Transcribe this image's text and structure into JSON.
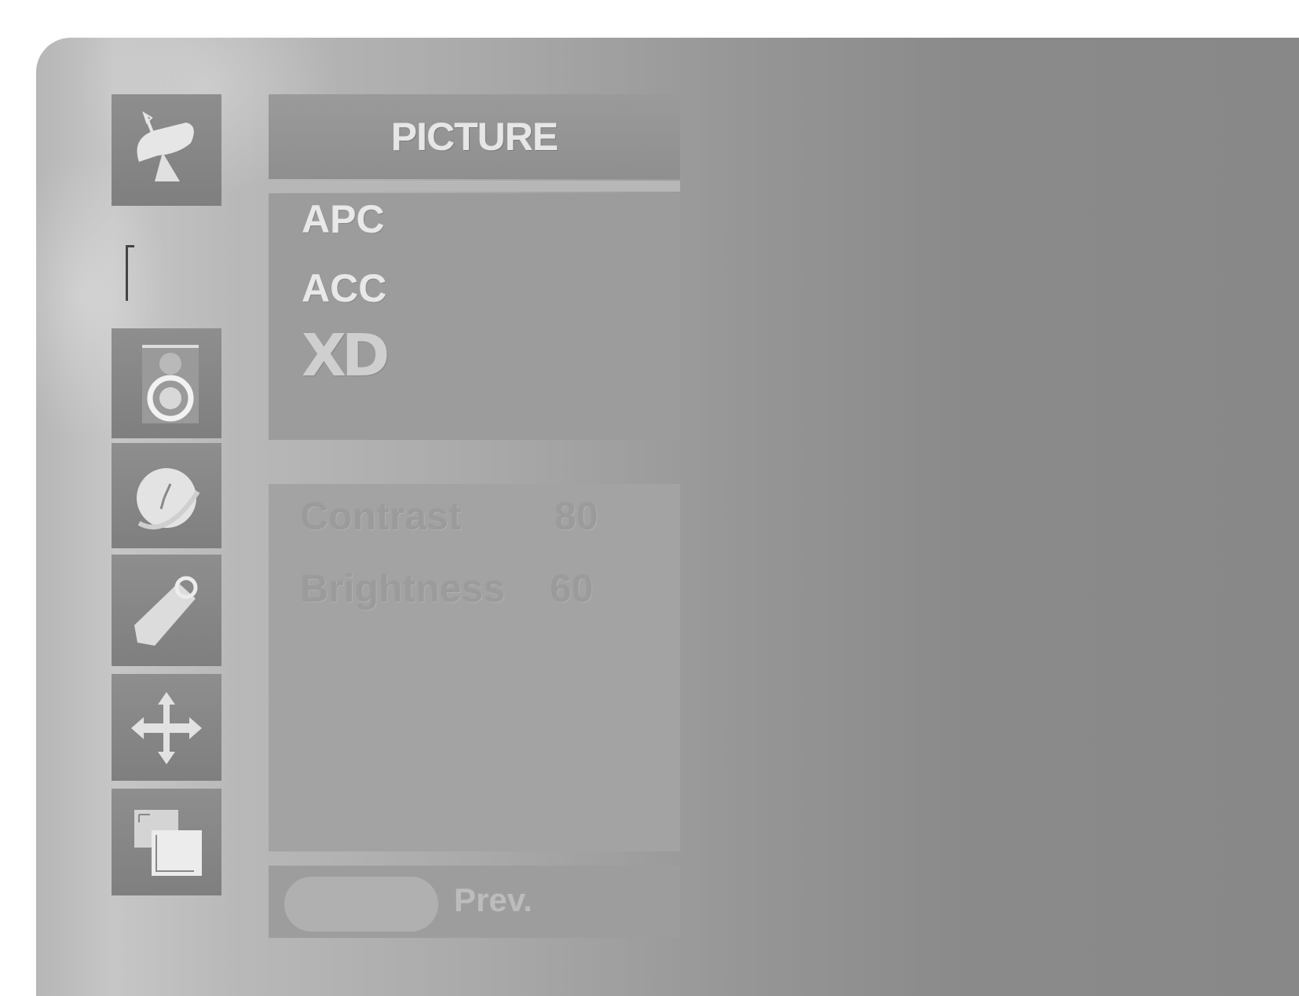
{
  "menu": {
    "title": "PICTURE",
    "items": [
      {
        "label": "APC"
      },
      {
        "label": "ACC"
      },
      {
        "label": "XD"
      }
    ]
  },
  "values": [
    {
      "label": "Contrast",
      "value": "80"
    },
    {
      "label": "Brightness",
      "value": "60"
    }
  ],
  "footer": {
    "prev_label": "Prev."
  },
  "sidebar": {
    "icons": [
      "satellite-dish-icon",
      "speaker-icon",
      "clock-icon",
      "key-tag-icon",
      "arrows-icon",
      "screen-layers-icon"
    ]
  },
  "colors": {
    "panel": "#a0a0a0",
    "tile": "#858585",
    "text_light": "#e8e8e8"
  }
}
